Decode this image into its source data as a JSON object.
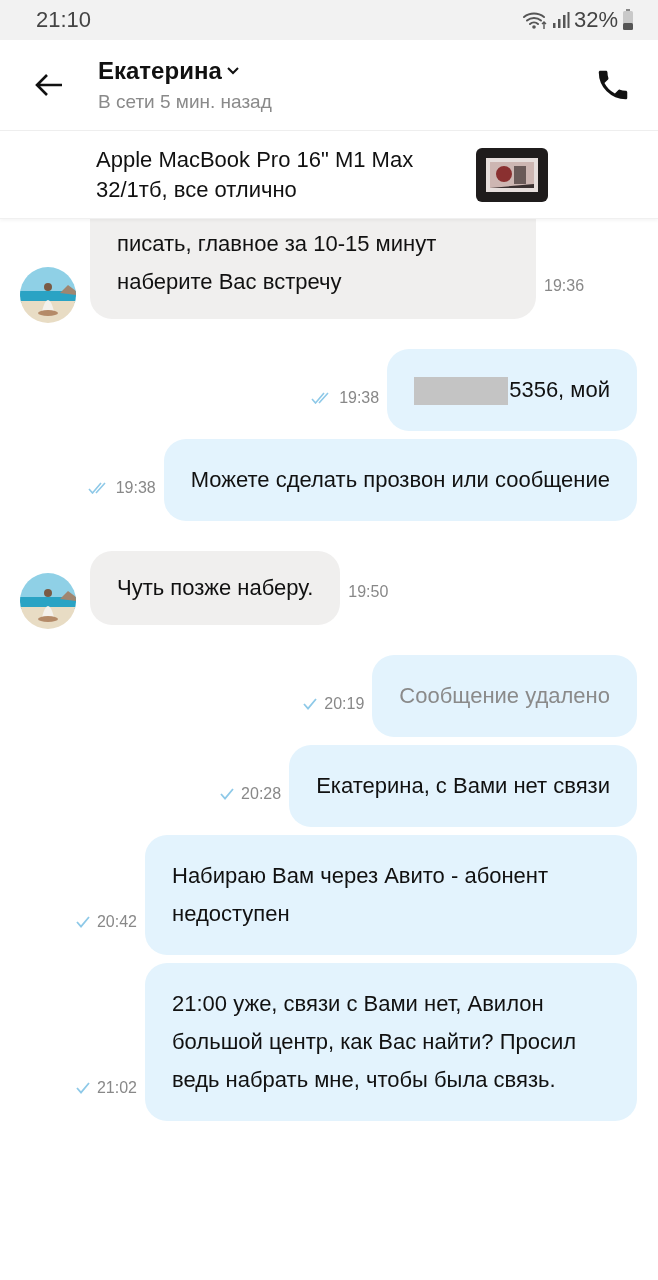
{
  "status_bar": {
    "time": "21:10",
    "battery": "32%"
  },
  "header": {
    "name": "Екатерина",
    "status": "В сети 5 мин. назад"
  },
  "listing": {
    "title": "Apple MacBook Pro 16\" M1 Max 32/1тб, все отлично"
  },
  "messages": [
    {
      "kind": "incoming",
      "text": "писать, главное за 10-15 минут наберите Вас встречу",
      "time": "19:36",
      "cut_top": true
    },
    {
      "kind": "outgoing",
      "text": "5356, мой",
      "time": "19:38",
      "read": true,
      "redacted": true
    },
    {
      "kind": "outgoing",
      "text": "Можете сделать прозвон или сообщение",
      "time": "19:38",
      "read": true
    },
    {
      "kind": "incoming",
      "text": "Чуть позже наберу.",
      "time": "19:50"
    },
    {
      "kind": "outgoing",
      "text": "Сообщение удалено",
      "time": "20:19",
      "read": false,
      "deleted": true
    },
    {
      "kind": "outgoing",
      "text": "Екатерина, с Вами нет связи",
      "time": "20:28",
      "read": false
    },
    {
      "kind": "outgoing",
      "text": "Набираю Вам через Авито - абонент недоступен",
      "time": "20:42",
      "read": false
    },
    {
      "kind": "outgoing",
      "text": "21:00 уже, связи с Вами нет, Авилон большой центр, как Вас найти? Просил ведь набрать мне, чтобы была связь.",
      "time": "21:02",
      "read": false
    }
  ]
}
